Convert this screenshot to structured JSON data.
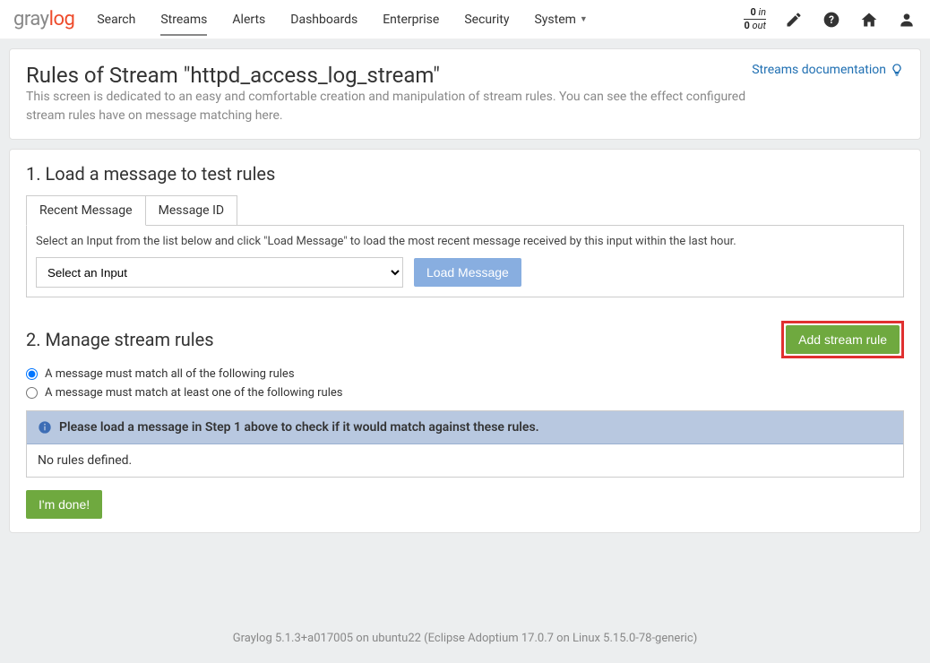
{
  "nav": {
    "search": "Search",
    "streams": "Streams",
    "alerts": "Alerts",
    "dashboards": "Dashboards",
    "enterprise": "Enterprise",
    "security": "Security",
    "system": "System"
  },
  "throughput": {
    "in_val": "0",
    "in_unit": "in",
    "out_val": "0",
    "out_unit": "out"
  },
  "header": {
    "title": "Rules of Stream \"httpd_access_log_stream\"",
    "desc": "This screen is dedicated to an easy and comfortable creation and manipulation of stream rules. You can see the effect configured stream rules have on message matching here.",
    "docs_link": "Streams documentation"
  },
  "section1": {
    "title": "1. Load a message to test rules",
    "tab_recent": "Recent Message",
    "tab_msgid": "Message ID",
    "hint": "Select an Input from the list below and click \"Load Message\" to load the most recent message received by this input within the last hour.",
    "select_placeholder": "Select an Input",
    "load_btn": "Load Message"
  },
  "section2": {
    "title": "2. Manage stream rules",
    "add_btn": "Add stream rule",
    "radio_all": "A message must match all of the following rules",
    "radio_any": "A message must match at least one of the following rules",
    "info": "Please load a message in Step 1 above to check if it would match against these rules.",
    "empty": "No rules defined.",
    "done": "I'm done!"
  },
  "footer": {
    "text": "Graylog 5.1.3+a017005 on ubuntu22 (Eclipse Adoptium 17.0.7 on Linux 5.15.0-78-generic)"
  }
}
